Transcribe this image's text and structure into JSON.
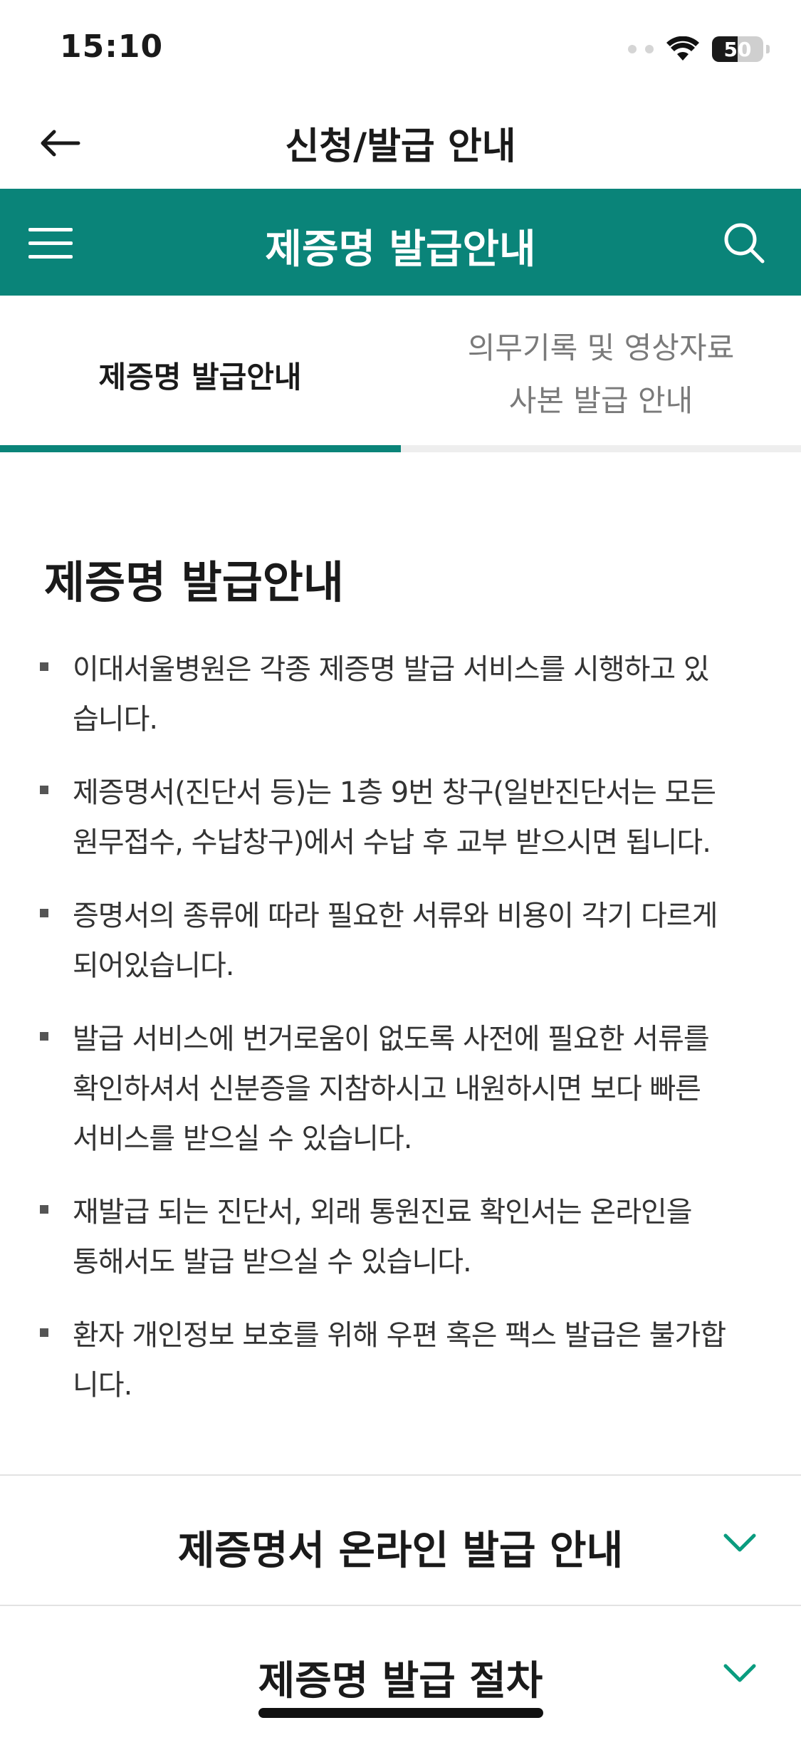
{
  "status_bar": {
    "time": "15:10",
    "battery": "50",
    "battery_level": 0.5
  },
  "header": {
    "title": "신청/발급 안내",
    "back_icon": "arrow-left-icon"
  },
  "section_bar": {
    "title": "제증명 발급안내",
    "menu_icon": "hamburger-menu-icon",
    "search_icon": "search-icon",
    "background": "#0a8479"
  },
  "tabs": [
    {
      "label": "제증명 발급안내",
      "active": true
    },
    {
      "label_line1": "의무기록 및 영상자료",
      "label_line2": "사본 발급 안내",
      "active": false
    }
  ],
  "content": {
    "title": "제증명 발급안내",
    "bullets": [
      {
        "line1": "이대서울병원은 각종 제증명 발급 서비스를 시행하고 있",
        "line2": "습니다."
      },
      {
        "line1": "제증명서(진단서 등)는 1층 9번 창구(일반진단서는 모든",
        "line2": "원무접수, 수납창구)에서 수납 후 교부 받으시면 됩니다."
      },
      {
        "line1": "증명서의 종류에 따라 필요한 서류와 비용이 각기 다르게",
        "line2": "되어있습니다."
      },
      {
        "line1": "발급 서비스에 번거로움이 없도록 사전에 필요한 서류를",
        "line2": "확인하셔서 신분증을 지참하시고 내원하시면 보다 빠른",
        "line3": "서비스를 받으실 수 있습니다."
      },
      {
        "line1": "재발급 되는 진단서, 외래 통원진료 확인서는 온라인을",
        "line2": "통해서도 발급 받으실 수 있습니다."
      },
      {
        "line1": "환자 개인정보 보호를 위해 우편 혹은 팩스 발급은 불가합",
        "line2": "니다."
      }
    ]
  },
  "accordions": [
    {
      "title": "제증명서 온라인 발급 안내",
      "icon": "chevron-down-icon"
    },
    {
      "title": "제증명 발급 절차",
      "icon": "chevron-down-icon"
    }
  ],
  "colors": {
    "accent": "#0a8479",
    "chevron": "#0a9c7f"
  }
}
